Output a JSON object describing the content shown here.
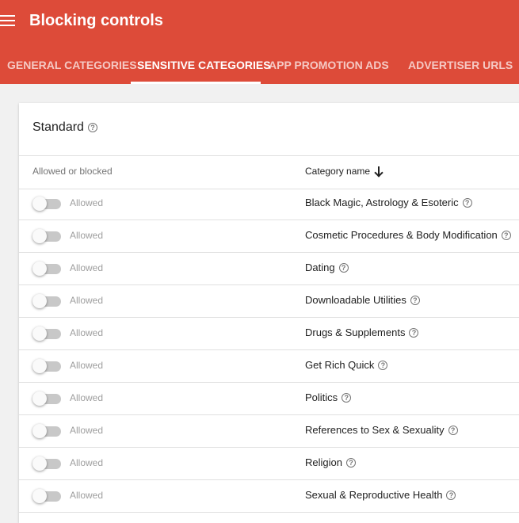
{
  "header": {
    "title": "Blocking controls",
    "tabs": [
      {
        "label": "GENERAL CATEGORIES"
      },
      {
        "label": "SENSITIVE CATEGORIES"
      },
      {
        "label": "APP PROMOTION ADS"
      },
      {
        "label": "ADVERTISER URLS"
      }
    ],
    "active_tab": "SENSITIVE CATEGORIES"
  },
  "card": {
    "title": "Standard",
    "columns": {
      "allowed": "Allowed or blocked",
      "category": "Category name"
    },
    "rows": [
      {
        "status": "Allowed",
        "category": "Black Magic, Astrology & Esoteric"
      },
      {
        "status": "Allowed",
        "category": "Cosmetic Procedures & Body Modification"
      },
      {
        "status": "Allowed",
        "category": "Dating"
      },
      {
        "status": "Allowed",
        "category": "Downloadable Utilities"
      },
      {
        "status": "Allowed",
        "category": "Drugs & Supplements"
      },
      {
        "status": "Allowed",
        "category": "Get Rich Quick"
      },
      {
        "status": "Allowed",
        "category": "Politics"
      },
      {
        "status": "Allowed",
        "category": "References to Sex & Sexuality"
      },
      {
        "status": "Allowed",
        "category": "Religion"
      },
      {
        "status": "Allowed",
        "category": "Sexual & Reproductive Health"
      }
    ]
  },
  "colors": {
    "topbar": "#dd4b39"
  }
}
